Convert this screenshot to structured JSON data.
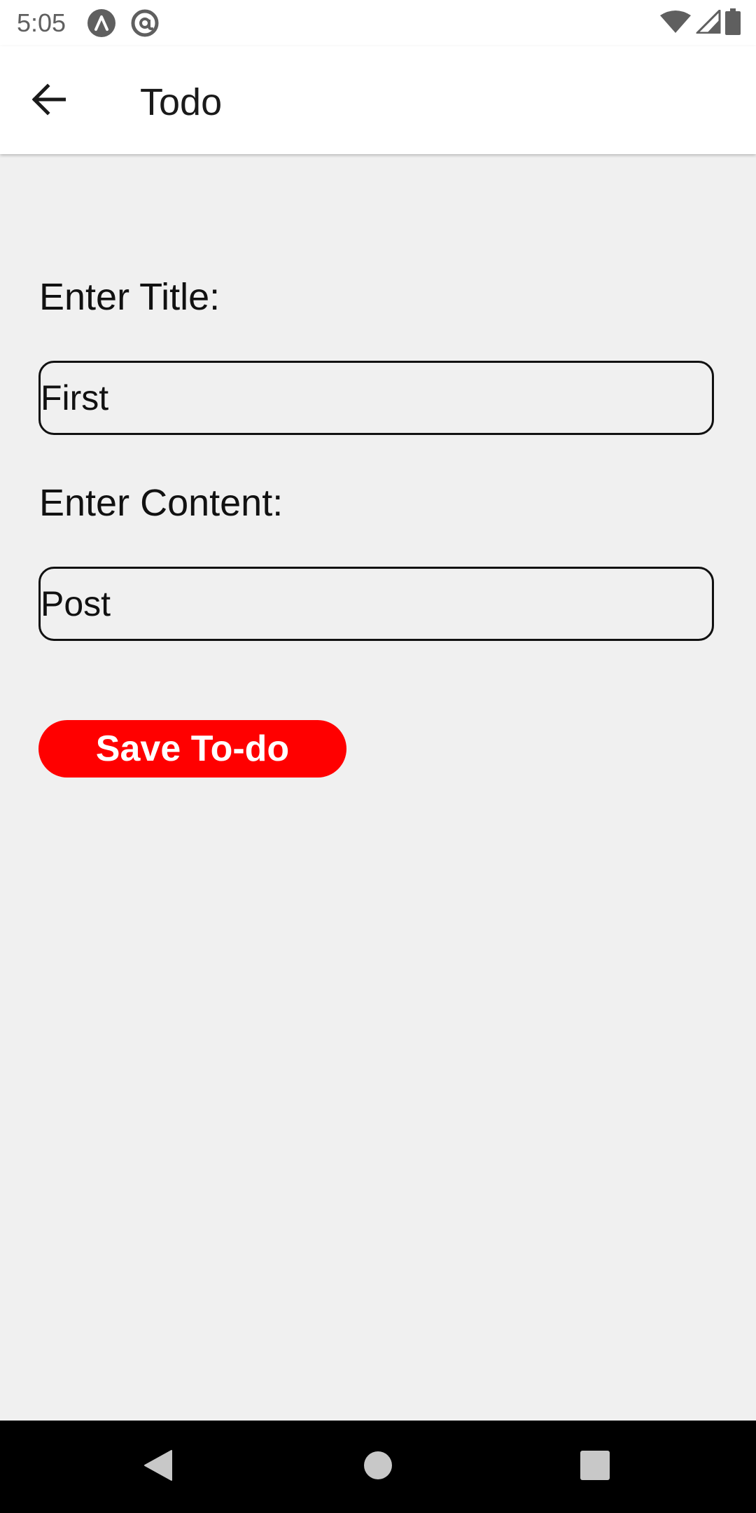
{
  "status_bar": {
    "time": "5:05",
    "icons": [
      "app-notification-icon",
      "at-sign-notification-icon",
      "wifi-icon",
      "cellular-signal-icon",
      "battery-icon"
    ]
  },
  "app_bar": {
    "title": "Todo",
    "back_icon": "arrow-back-icon"
  },
  "form": {
    "title_label": "Enter Title:",
    "title_value": "First",
    "content_label": "Enter Content:",
    "content_value": "Post",
    "save_label": "Save To-do"
  },
  "nav_bar": {
    "icons": [
      "back-triangle-icon",
      "home-circle-icon",
      "recents-square-icon"
    ]
  },
  "colors": {
    "accent": "#ff0000",
    "background": "#f0f0f0",
    "app_bar": "#ffffff",
    "nav_bar": "#000000"
  }
}
